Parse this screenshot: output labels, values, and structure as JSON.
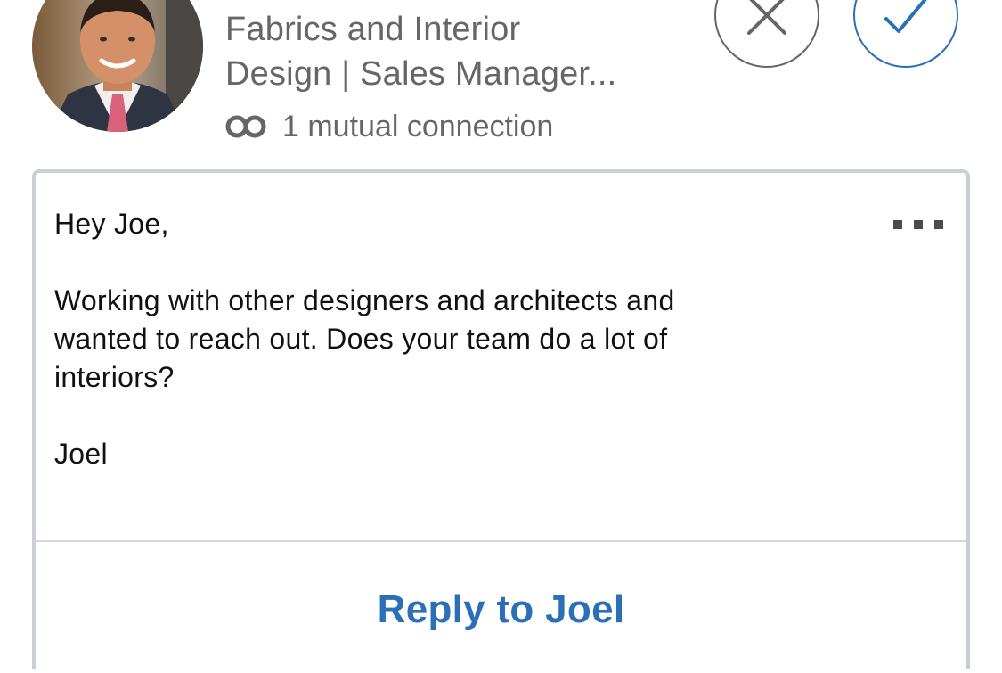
{
  "invitation": {
    "headline_line1": "Fabrics and Interior",
    "headline_line2": "Design | Sales Manager...",
    "mutual_connections": "1 mutual connection",
    "icons": {
      "avatar": "profile-photo",
      "mutual": "mutual-connections-icon",
      "ignore": "close-icon",
      "accept": "checkmark-icon"
    }
  },
  "message": {
    "greeting": "Hey Joe,",
    "body_lines": [
      "Working with other designers and architects and",
      "wanted to reach out. Does your team do a lot of",
      "interiors?"
    ],
    "signoff": "Joel",
    "more_icon": "ellipsis-icon",
    "reply_label": "Reply to Joel"
  },
  "colors": {
    "accent": "#2a6fb8",
    "muted_text": "#666666",
    "card_border": "#c9cfd6"
  }
}
